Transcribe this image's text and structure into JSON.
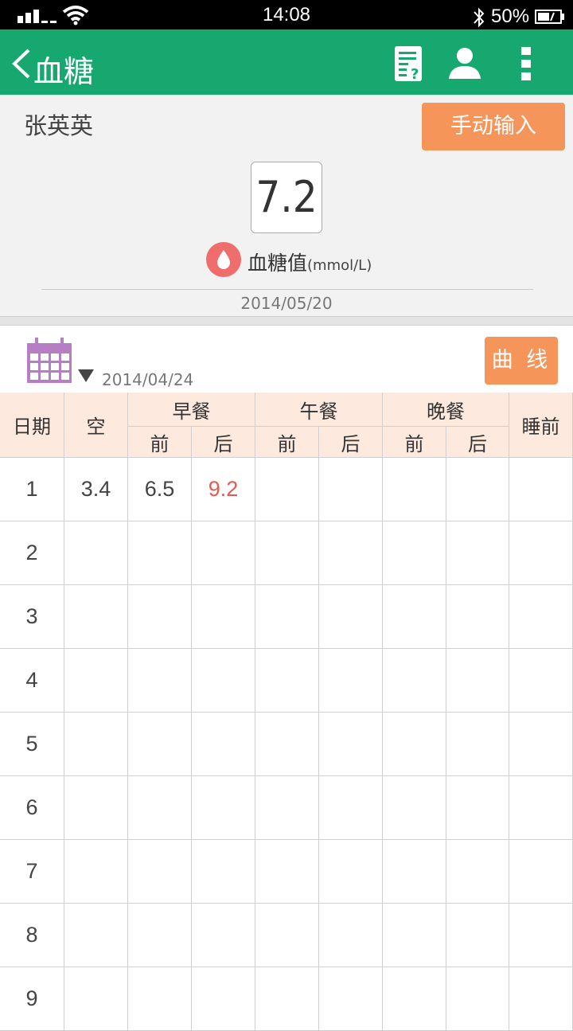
{
  "status_bar": {
    "time": "14:08",
    "battery": "50%"
  },
  "title_bar": {
    "title": "血糖",
    "icons": [
      "back-icon",
      "question-document-icon",
      "user-icon",
      "more-vertical-icon"
    ]
  },
  "header": {
    "patient_name": "张英英",
    "manual_input_label": "手动输入",
    "value": "7.2",
    "value_label": "血糖值",
    "value_unit": "(mmol/L)",
    "date": "2014/05/20"
  },
  "toolbar": {
    "selected_date": "2014/04/24",
    "curve_label": "曲 线"
  },
  "table": {
    "headers": {
      "date": "日期",
      "empty": "空",
      "breakfast": "早餐",
      "lunch": "午餐",
      "dinner": "晚餐",
      "bedtime": "睡前",
      "before": "前",
      "after": "后"
    },
    "rows": [
      {
        "day": "1",
        "fasting": "3.4",
        "breakfast_before": "6.5",
        "breakfast_after": "9.2",
        "lunch_before": "",
        "lunch_after": "",
        "dinner_before": "",
        "dinner_after": "",
        "bedtime": ""
      },
      {
        "day": "2",
        "fasting": "",
        "breakfast_before": "",
        "breakfast_after": "",
        "lunch_before": "",
        "lunch_after": "",
        "dinner_before": "",
        "dinner_after": "",
        "bedtime": ""
      },
      {
        "day": "3",
        "fasting": "",
        "breakfast_before": "",
        "breakfast_after": "",
        "lunch_before": "",
        "lunch_after": "",
        "dinner_before": "",
        "dinner_after": "",
        "bedtime": ""
      },
      {
        "day": "4",
        "fasting": "",
        "breakfast_before": "",
        "breakfast_after": "",
        "lunch_before": "",
        "lunch_after": "",
        "dinner_before": "",
        "dinner_after": "",
        "bedtime": ""
      },
      {
        "day": "5",
        "fasting": "",
        "breakfast_before": "",
        "breakfast_after": "",
        "lunch_before": "",
        "lunch_after": "",
        "dinner_before": "",
        "dinner_after": "",
        "bedtime": ""
      },
      {
        "day": "6",
        "fasting": "",
        "breakfast_before": "",
        "breakfast_after": "",
        "lunch_before": "",
        "lunch_after": "",
        "dinner_before": "",
        "dinner_after": "",
        "bedtime": ""
      },
      {
        "day": "7",
        "fasting": "",
        "breakfast_before": "",
        "breakfast_after": "",
        "lunch_before": "",
        "lunch_after": "",
        "dinner_before": "",
        "dinner_after": "",
        "bedtime": ""
      },
      {
        "day": "8",
        "fasting": "",
        "breakfast_before": "",
        "breakfast_after": "",
        "lunch_before": "",
        "lunch_after": "",
        "dinner_before": "",
        "dinner_after": "",
        "bedtime": ""
      },
      {
        "day": "9",
        "fasting": "",
        "breakfast_before": "",
        "breakfast_after": "",
        "lunch_before": "",
        "lunch_after": "",
        "dinner_before": "",
        "dinner_after": "",
        "bedtime": ""
      }
    ],
    "high_value_color": "#e85a4f"
  },
  "colors": {
    "title_bar": "#16a86f",
    "accent_button": "#f5955a",
    "table_header": "#fde9dd",
    "drop_icon": "#ef6d6d",
    "calendar_icon": "#b77fc3"
  }
}
